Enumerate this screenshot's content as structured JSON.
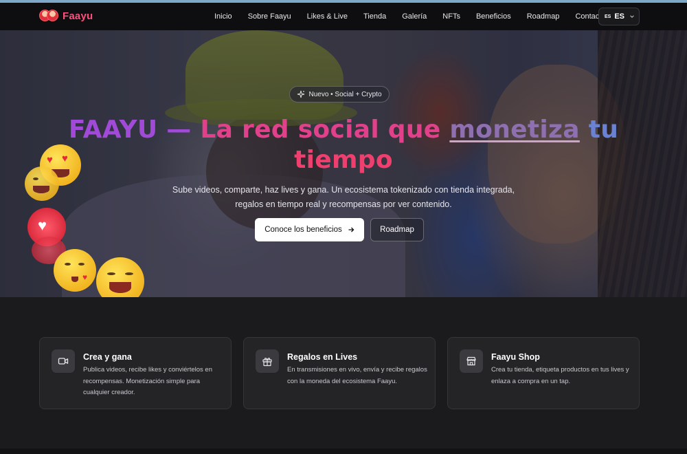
{
  "brand": {
    "name": "Faayu"
  },
  "nav": {
    "links": [
      "Inicio",
      "Sobre Faayu",
      "Likes & Live",
      "Tienda",
      "Galería",
      "NFTs",
      "Beneficios",
      "Roadmap",
      "Contacto"
    ],
    "language": {
      "flag": "ES",
      "code": "ES"
    }
  },
  "hero": {
    "pill": "Nuevo • Social + Crypto",
    "title": {
      "part1": "FAAYU —",
      "part2": "La red social que",
      "part3": "monetiza",
      "part4": "tu",
      "part5": "tiempo"
    },
    "subtitle": "Sube videos, comparte, haz lives y gana. Un ecosistema tokenizado con tienda integrada, regalos en tiempo real y recompensas por ver contenido.",
    "primary_button": "Conoce los beneficios",
    "secondary_button": "Roadmap"
  },
  "features": [
    {
      "title": "Crea y gana",
      "description": "Publica videos, recibe likes y conviértelos en recompensas. Monetización simple para cualquier creador.",
      "icon": "video-camera-icon"
    },
    {
      "title": "Regalos en Lives",
      "description": "En transmisiones en vivo, envía y recibe regalos con la moneda del ecosistema Faayu.",
      "icon": "gift-icon"
    },
    {
      "title": "Faayu Shop",
      "description": "Crea tu tienda, etiqueta productos en tus lives y enlaza a compra en un tap.",
      "icon": "store-icon"
    }
  ],
  "colors": {
    "brand": "#ff4f7e",
    "title_purple": "#a14ad8",
    "title_pink": "#e0418a",
    "title_blue": "#6a82d4"
  }
}
